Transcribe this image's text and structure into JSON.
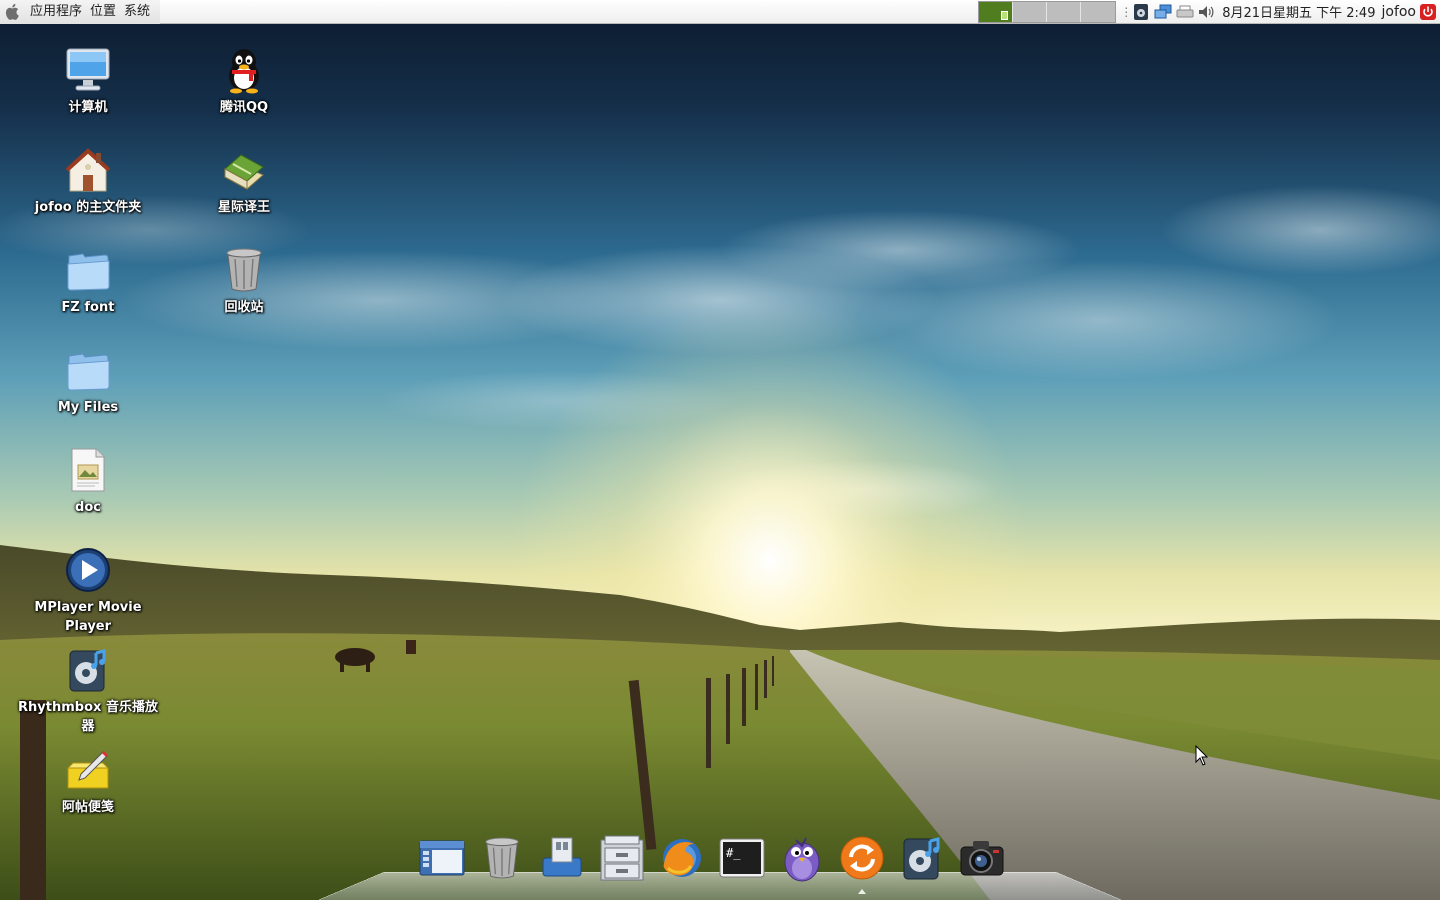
{
  "top_panel": {
    "menus": [
      "应用程序",
      "位置",
      "系统"
    ],
    "clock": "8月21日星期五 下午 2:49",
    "user": "jofoo",
    "workspaces": 4,
    "active_workspace": 1,
    "tray_icons": [
      "rhythmbox-icon",
      "network-icon",
      "printer-icon",
      "volume-icon"
    ]
  },
  "desktop": {
    "icons": [
      {
        "label": "计算机",
        "icon": "computer-icon"
      },
      {
        "label": "腾讯QQ",
        "icon": "qq-penguin-icon"
      },
      {
        "label": "jofoo 的主文件夹",
        "icon": "home-folder-icon"
      },
      {
        "label": "星际译王",
        "icon": "dictionary-book-icon"
      },
      {
        "label": "FZ font",
        "icon": "folder-icon"
      },
      {
        "label": "回收站",
        "icon": "trash-icon"
      },
      {
        "label": "My Files",
        "icon": "folder-icon"
      },
      {
        "label": "doc",
        "icon": "document-icon"
      },
      {
        "label": "MPlayer Movie Player",
        "icon": "mplayer-icon"
      },
      {
        "label": "Rhythmbox 音乐播放器",
        "icon": "rhythmbox-icon"
      },
      {
        "label": "阿帖便笺",
        "icon": "sticky-note-icon"
      }
    ]
  },
  "dock": {
    "items": [
      {
        "name": "file-browser-icon"
      },
      {
        "name": "trash-icon"
      },
      {
        "name": "save-drive-icon"
      },
      {
        "name": "file-cabinet-icon"
      },
      {
        "name": "firefox-icon"
      },
      {
        "name": "terminal-icon",
        "glyph": "#_"
      },
      {
        "name": "pidgin-bird-icon"
      },
      {
        "name": "update-manager-icon"
      },
      {
        "name": "rhythmbox-icon"
      },
      {
        "name": "camera-icon"
      }
    ],
    "running": [
      7
    ]
  },
  "colors": {
    "panel_bg": "#eeeeee",
    "active_workspace": "#4f7d1f",
    "label_text": "#ffffff"
  }
}
